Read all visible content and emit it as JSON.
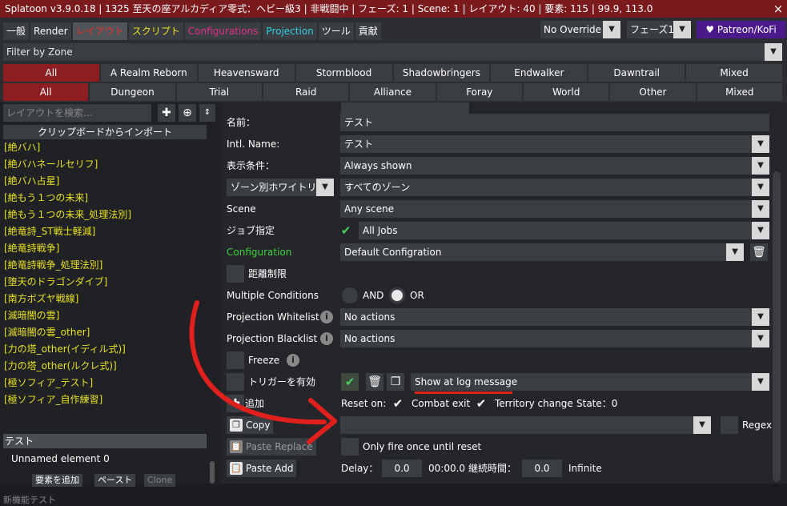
{
  "window": {
    "title": "Splatoon v3.9.0.18 | 1325 至天の座アルカディア零式：ヘビー級3 | 非戦闘中 | フェーズ: 1 | Scene: 1 | レイアウト: 40 | 要素: 115 | 99.9, 113.0",
    "close": "×"
  },
  "tabs": [
    {
      "label": "一般",
      "color": "#ffffff"
    },
    {
      "label": "Render",
      "color": "#ffffff"
    },
    {
      "label": "レイアウト",
      "color": "#e8302a"
    },
    {
      "label": "スクリプト",
      "color": "#e8e020"
    },
    {
      "label": "Configurations",
      "color": "#e0308a"
    },
    {
      "label": "Projection",
      "color": "#30d0e0"
    },
    {
      "label": "ツール",
      "color": "#ffffff"
    },
    {
      "label": "貢献",
      "color": "#ffffff"
    }
  ],
  "override": {
    "value": "No Override"
  },
  "phase": {
    "value": "フェーズ1"
  },
  "patreon": "♥ Patreon/KoFi",
  "filter": {
    "label": "Filter by Zone"
  },
  "expansions": [
    "All",
    "A Realm Reborn",
    "Heavensward",
    "Stormblood",
    "Shadowbringers",
    "Endwalker",
    "Dawntrail",
    "Mixed"
  ],
  "categories": [
    "All",
    "Dungeon",
    "Trial",
    "Raid",
    "Alliance",
    "Foray",
    "World",
    "Other",
    "Mixed"
  ],
  "left": {
    "search_placeholder": "レイアウトを検索...",
    "import": "クリップボードからインポート",
    "layouts": [
      "[絶バハ]",
      "[絶バハネールセリフ]",
      "[絶バハ占星]",
      "[絶もう１つの未来]",
      "[絶もう１つの未来_処理法別]",
      "[絶竜詩_ST戦士軽減]",
      "[絶竜詩戦争]",
      "[絶竜詩戦争_処理法別]",
      "[堕天のドラゴンダイブ]",
      "[南方ボズヤ戦線]",
      "[滅暗闇の雲]",
      "[滅暗闇の雲_other]",
      "[力の塔_other(イディル式)]",
      "[力の塔_other(ルクレ式)]",
      "[極ソフィア_テスト]",
      "[極ソフィア_自作練習]"
    ],
    "selected_group": "テスト",
    "element": "Unnamed element 0",
    "add_element": "要素を追加",
    "paste": "ペースト",
    "clone": "Clone",
    "new_features": "新機能テスト"
  },
  "form": {
    "name_label": "名前：",
    "name_value": "テスト",
    "intl_label": "Intl. Name:",
    "intl_value": "テスト",
    "display_label": "表示条件：",
    "display_value": "Always shown",
    "zone_label": "ゾーン別ホワイトリ",
    "zone_value": "すべてのゾーン",
    "scene_label": "Scene",
    "scene_value": "Any scene",
    "job_label": "ジョブ指定",
    "job_value": "All Jobs",
    "config_label": "Configuration",
    "config_value": "Default Configration",
    "distance_label": "距離制限",
    "multi_label": "Multiple Conditions",
    "and_label": "AND",
    "or_label": "OR",
    "pwl_label": "Projection Whitelist",
    "pwl_value": "No actions",
    "pbl_label": "Projection Blacklist",
    "pbl_value": "No actions",
    "freeze_label": "Freeze",
    "trigger_label": "トリガーを有効",
    "trigger_value": "Show at log message",
    "add_label": "追加",
    "reset_label": "Reset on:",
    "combat_exit": "Combat exit",
    "territory_change": "Territory change",
    "state_label": "State：0",
    "copy": "Copy",
    "paste_replace": "Paste Replace",
    "paste_add": "Paste Add",
    "regex": "Regex",
    "once_label": "Only fire once until reset",
    "delay_label": "Delay：",
    "delay_value": "0.0",
    "delay_time": "00:00.0",
    "duration_label": "継続時間：",
    "duration_value": "0.0",
    "infinite": "Infinite"
  },
  "colors": {
    "accent_red": "#8c1e22",
    "annotation": "#e0201c",
    "layout_text": "#e8e020",
    "check": "#4ad060",
    "config_label": "#40d040"
  }
}
